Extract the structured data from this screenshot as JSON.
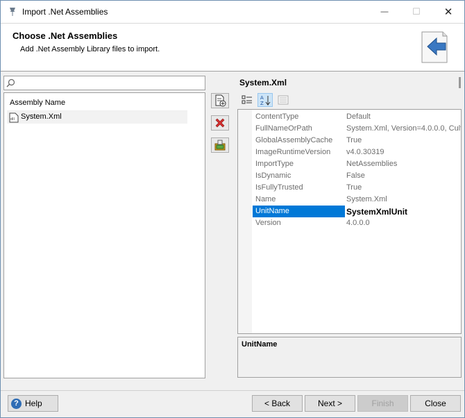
{
  "window": {
    "title": "Import .Net Assemblies",
    "minimize_glyph": "—",
    "maximize_glyph": "☐",
    "close_glyph": "✕"
  },
  "header": {
    "title": "Choose .Net Assemblies",
    "subtitle": "Add .Net Assembly Library files to import."
  },
  "search": {
    "value": "",
    "placeholder": ""
  },
  "assembly_list": {
    "column_header": "Assembly Name",
    "items": [
      {
        "label": "System.Xml",
        "icon": "dll-file-icon"
      }
    ]
  },
  "side_buttons": [
    {
      "name": "add-assembly-button",
      "icon": "add-document-icon"
    },
    {
      "name": "remove-assembly-button",
      "icon": "red-x-icon"
    },
    {
      "name": "assembly-options-button",
      "icon": "package-icon"
    }
  ],
  "properties": {
    "title": "System.Xml",
    "rows": [
      {
        "name": "ContentType",
        "value": "Default"
      },
      {
        "name": "FullNameOrPath",
        "value": "System.Xml, Version=4.0.0.0, Cult"
      },
      {
        "name": "GlobalAssemblyCache",
        "value": "True"
      },
      {
        "name": "ImageRuntimeVersion",
        "value": "v4.0.30319"
      },
      {
        "name": "ImportType",
        "value": "NetAssemblies"
      },
      {
        "name": "IsDynamic",
        "value": "False"
      },
      {
        "name": "IsFullyTrusted",
        "value": "True"
      },
      {
        "name": "Name",
        "value": "System.Xml"
      },
      {
        "name": "UnitName",
        "value": "SystemXmlUnit",
        "selected": true
      },
      {
        "name": "Version",
        "value": "4.0.0.0"
      }
    ],
    "description_title": "UnitName"
  },
  "buttons": {
    "help": "Help",
    "back": "< Back",
    "next": "Next >",
    "finish": "Finish",
    "close": "Close"
  },
  "colors": {
    "selection": "#0078d7",
    "accent_blue": "#2f6db5",
    "delete_red": "#d32f2f"
  }
}
